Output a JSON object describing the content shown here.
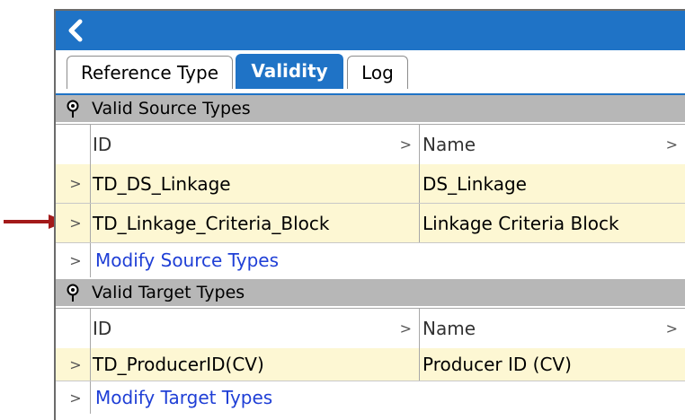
{
  "titlebar": {
    "back_icon": "chevron-left-icon",
    "color": "#1f73c6"
  },
  "tabs": [
    {
      "label": "Reference Type",
      "active": false
    },
    {
      "label": "Validity",
      "active": true
    },
    {
      "label": "Log",
      "active": false
    }
  ],
  "source_section": {
    "title": "Valid Source Types",
    "columns": [
      "ID",
      "Name"
    ],
    "rows": [
      {
        "id": "TD_DS_Linkage",
        "name": "DS_Linkage"
      },
      {
        "id": "TD_Linkage_Criteria_Block",
        "name": "Linkage Criteria Block"
      }
    ],
    "modify_link": "Modify Source Types"
  },
  "target_section": {
    "title": "Valid Target Types",
    "columns": [
      "ID",
      "Name"
    ],
    "rows": [
      {
        "id": "TD_ProducerID(CV)",
        "name": "Producer ID (CV)"
      }
    ],
    "modify_link": "Modify Target Types"
  },
  "annotation": {
    "arrow_color": "#a31a1a"
  }
}
